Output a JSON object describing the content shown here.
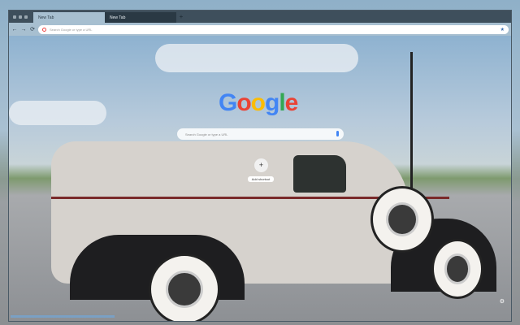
{
  "tabs": [
    {
      "label": "New Tab",
      "active": true
    },
    {
      "label": "New Tab",
      "active": false
    }
  ],
  "toolbar": {
    "back": "←",
    "forward": "→",
    "reload": "⟳",
    "omnibox_placeholder": "Search Google or type a URL",
    "star": "★"
  },
  "ntp": {
    "logo": [
      "G",
      "o",
      "o",
      "g",
      "l",
      "e"
    ],
    "logo_colors": [
      "#4285f4",
      "#ea4335",
      "#fbbc05",
      "#4285f4",
      "#34a853",
      "#ea4335"
    ],
    "search_placeholder": "Search Google or type a URL",
    "shortcut_icon": "+",
    "shortcut_label": "Add shortcut",
    "customize": "⚙"
  },
  "newtab_symbol": "+"
}
